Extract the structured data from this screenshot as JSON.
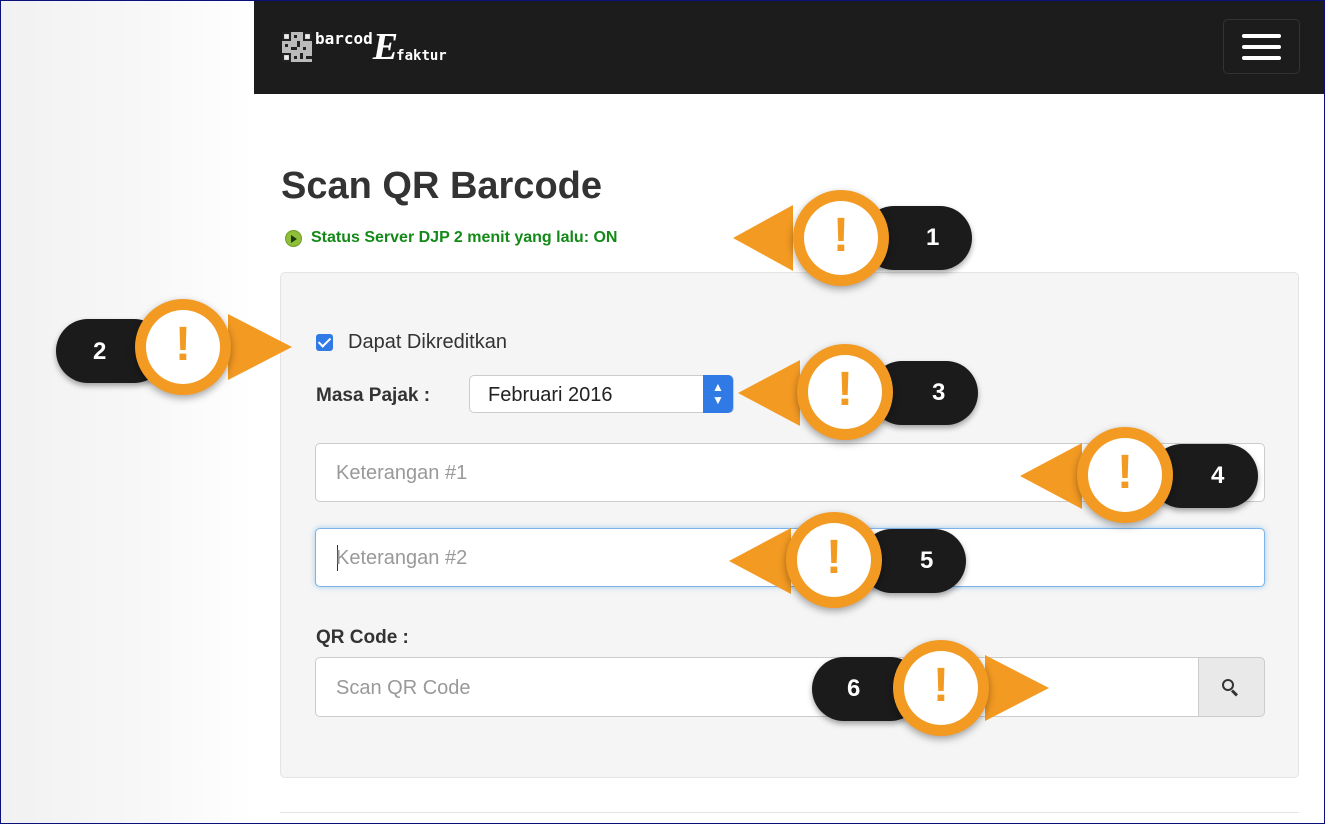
{
  "app": {
    "logo_text_1": "barcod",
    "logo_text_E": "E",
    "logo_text_2": "faktur"
  },
  "page": {
    "title": "Scan QR Barcode",
    "status": "Status Server DJP 2 menit yang lalu: ON"
  },
  "form": {
    "checkbox_label": "Dapat Dikreditkan",
    "checkbox_checked": true,
    "masa_pajak_label": "Masa Pajak :",
    "masa_pajak_value": "Februari 2016",
    "keterangan1_placeholder": "Keterangan #1",
    "keterangan2_placeholder": "Keterangan #2",
    "qr_label": "QR Code :",
    "qr_placeholder": "Scan QR Code"
  },
  "callouts": [
    {
      "number": "1",
      "mark": "!"
    },
    {
      "number": "2",
      "mark": "!"
    },
    {
      "number": "3",
      "mark": "!"
    },
    {
      "number": "4",
      "mark": "!"
    },
    {
      "number": "5",
      "mark": "!"
    },
    {
      "number": "6",
      "mark": "!"
    }
  ],
  "colors": {
    "navbar": "#1c1c1c",
    "accent_blue": "#2f7ae5",
    "status_green": "#138a18",
    "callout_orange": "#f39a23",
    "callout_dark": "#1b1b1b"
  },
  "icons": {
    "menu": "hamburger-icon",
    "search": "magnifier-icon",
    "status": "play-icon"
  }
}
